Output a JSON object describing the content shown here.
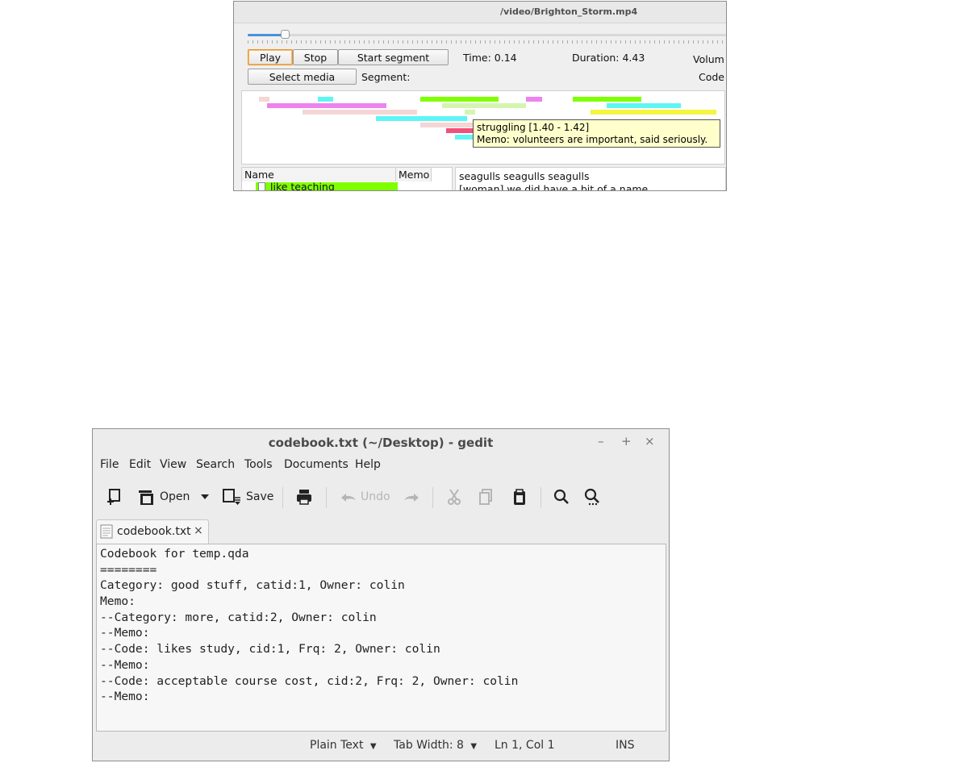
{
  "video_window": {
    "title": "/video/Brighton_Storm.mp4",
    "slider": {
      "progress": 0.078
    },
    "buttons": {
      "play": "Play",
      "stop": "Stop",
      "start_segment": "Start segment",
      "select_media": "Select media"
    },
    "labels": {
      "time": "Time: 0.14",
      "duration": "Duration: 4.43",
      "volume": "Volum",
      "segment": "Segment:",
      "code": "Code"
    },
    "timeline_colors": [
      "#f5d5d5",
      "#ee82ee",
      "#5ff5f5",
      "#7fff00",
      "#d4f5b0",
      "#f0507a",
      "#f5f542"
    ],
    "tooltip": {
      "line1": "struggling [1.40 - 1.42]",
      "line2": "Memo: volunteers are important, said seriously."
    },
    "code_tree": {
      "columns": [
        "Name",
        "Memo"
      ],
      "row_label": "like teaching",
      "row_color": "#7fff00"
    },
    "transcript": [
      "seagulls seagulls seagulls",
      "[woman] we did have a bit of a name"
    ]
  },
  "gedit": {
    "title": "codebook.txt (~/Desktop) - gedit",
    "window_controls": [
      "–",
      "+",
      "×"
    ],
    "menu": [
      "File",
      "Edit",
      "View",
      "Search",
      "Tools",
      "Documents",
      "Help"
    ],
    "toolbar": {
      "open": "Open",
      "save": "Save",
      "undo": "Undo"
    },
    "tab": {
      "label": "codebook.txt",
      "close": "×"
    },
    "content": [
      "Codebook for temp.qda",
      "========",
      "Category: good stuff, catid:1, Owner: colin",
      "Memo:",
      "--Category: more, catid:2, Owner: colin",
      "--Memo:",
      "--Code: likes study, cid:1, Frq: 2, Owner: colin",
      "--Memo:",
      "--Code: acceptable course cost, cid:2, Frq: 2, Owner: colin",
      "--Memo:"
    ],
    "statusbar": {
      "language": "Plain Text",
      "tab_width": "Tab Width:  8",
      "position": "Ln 1, Col 1",
      "mode": "INS"
    }
  }
}
